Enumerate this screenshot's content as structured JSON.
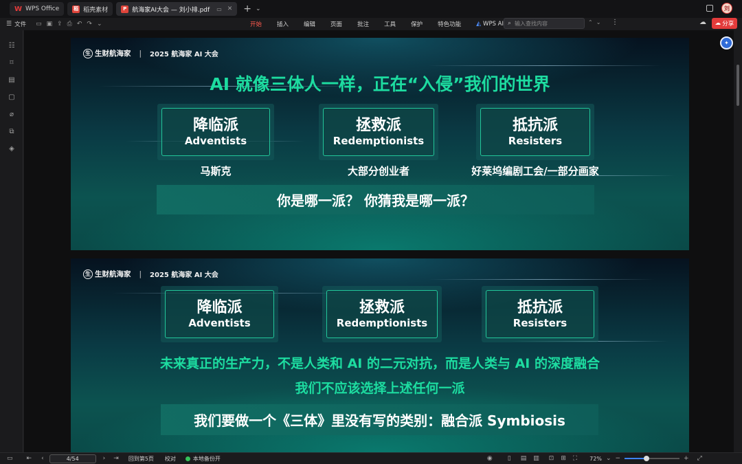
{
  "tabs": [
    {
      "label": "WPS Office",
      "icon": "wps-logo-icon",
      "active": false
    },
    {
      "label": "稻壳素材",
      "icon": "docer-icon",
      "active": false
    },
    {
      "label": "航海家AI大会 — 刘小排.pdf",
      "icon": "pdf-icon",
      "active": true
    }
  ],
  "toolbar": {
    "file_label": "文件",
    "ribbon_tabs": [
      "开始",
      "插入",
      "编辑",
      "页面",
      "批注",
      "工具",
      "保护",
      "特色功能"
    ],
    "wps_ai_label": "WPS AI",
    "search_placeholder": "输入查找内容",
    "share_label": "分享",
    "accent": "#ff5a4e"
  },
  "sidebar": {
    "icons": [
      "outline-icon",
      "bookmark-icon",
      "thumbnail-icon",
      "comment-icon",
      "attachment-icon",
      "compare-icon",
      "layers-icon"
    ]
  },
  "slides": [
    {
      "brand": "生财航海家",
      "conference": "2025 航海家 AI 大会",
      "headline": "AI 就像三体人一样，正在“入侵”我们的世界",
      "cards": [
        {
          "zh": "降临派",
          "en": "Adventists"
        },
        {
          "zh": "拯救派",
          "en": "Redemptionists"
        },
        {
          "zh": "抵抗派",
          "en": "Resisters"
        }
      ],
      "figures": [
        "马斯克",
        "大部分创业者",
        "好莱坞编剧工会/一部分画家"
      ],
      "banner": "你是哪一派？ 你猜我是哪一派？"
    },
    {
      "brand": "生财航海家",
      "conference": "2025 航海家 AI 大会",
      "cards": [
        {
          "zh": "降临派",
          "en": "Adventists"
        },
        {
          "zh": "拯救派",
          "en": "Redemptionists"
        },
        {
          "zh": "抵抗派",
          "en": "Resisters"
        }
      ],
      "line1": "未来真正的生产力，不是人类和 AI 的二元对抗，而是人类与 AI 的深度融合",
      "line2": "我们不应该选择上述任何一派",
      "banner": "我们要做一个《三体》里没有写的类别：融合派 Symbiosis"
    }
  ],
  "statusbar": {
    "page_value": "4/54",
    "back_label": "回到第5页",
    "proofread_label": "校对",
    "backup_label": "本地备份开",
    "zoom_label": "72%",
    "zoom_fraction": 0.72
  },
  "colors": {
    "headline": "#1ddca0",
    "card_border": "#22c79a",
    "share": "#e33b3b"
  }
}
